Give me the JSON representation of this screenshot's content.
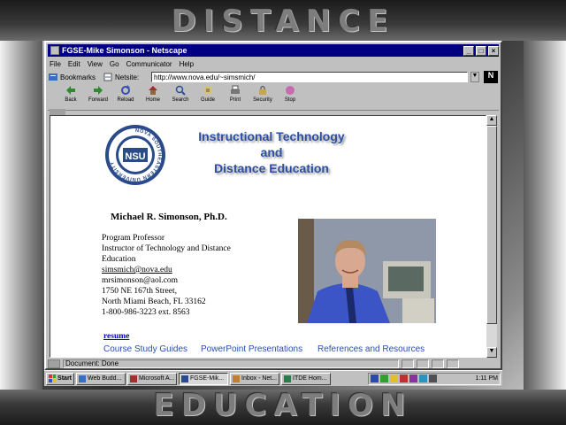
{
  "banner": {
    "top": "DISTANCE",
    "bottom": "EDUCATION"
  },
  "window": {
    "title": "FGSE-Mike Simonson - Netscape",
    "controls": {
      "minimize": "_",
      "maximize": "□",
      "close": "×"
    }
  },
  "menu": [
    "File",
    "Edit",
    "View",
    "Go",
    "Communicator",
    "Help"
  ],
  "location": {
    "bookmarks_label": "Bookmarks",
    "netsite_label": "Netsite:",
    "url": "http://www.nova.edu/~simsmich/"
  },
  "toolbar": [
    "Back",
    "Forward",
    "Reload",
    "Home",
    "Search",
    "Guide",
    "Print",
    "Security",
    "Stop"
  ],
  "page": {
    "header_title_lines": [
      "Instructional Technology",
      "and",
      "Distance Education"
    ],
    "seal_text": "NSU",
    "seal_ring_text": "NOVA SOUTHEASTERN UNIVERSITY",
    "name": "Michael R. Simonson, Ph.D.",
    "info_lines": [
      "Program Professor",
      "Instructor of Technology and Distance",
      "Education",
      "simsmich@nova.edu",
      "mrsimonson@aol.com",
      "1750 NE 167th Street,",
      "North Miami Beach, FL 33162",
      "1-800-986-3223 ext. 8563"
    ],
    "resume": "resume",
    "bottom_links": [
      "Course Study Guides",
      "PowerPoint Presentations",
      "References and Resources"
    ]
  },
  "status": {
    "text": "Document: Done"
  },
  "taskbar": {
    "start": "Start",
    "tasks": [
      "Web Budd...",
      "Microsoft A...",
      "FGSE-Mik...",
      "Inbox - Net...",
      "ITDE Hom..."
    ],
    "active_index": 2,
    "clock": "1:11 PM"
  }
}
